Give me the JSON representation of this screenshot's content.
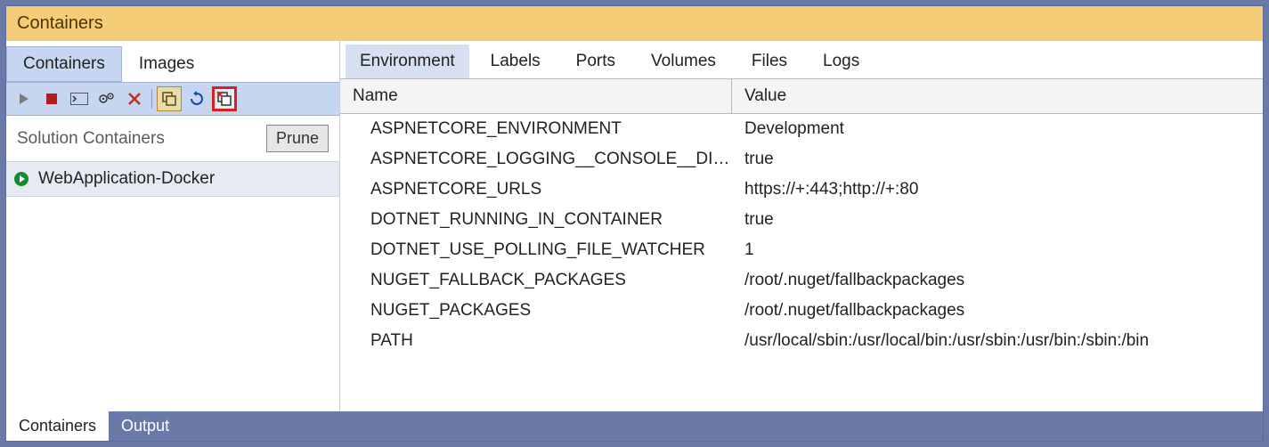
{
  "title": "Containers",
  "leftTabs": {
    "containers": "Containers",
    "images": "Images",
    "active": "containers"
  },
  "sidebar": {
    "sectionTitle": "Solution Containers",
    "tooltip": "Prune",
    "items": [
      {
        "label": "WebApplication-Docker",
        "running": true
      }
    ]
  },
  "rightTabs": {
    "items": [
      "Environment",
      "Labels",
      "Ports",
      "Volumes",
      "Files",
      "Logs"
    ],
    "active": 0
  },
  "table": {
    "columns": {
      "name": "Name",
      "value": "Value"
    },
    "rows": [
      {
        "name": "ASPNETCORE_ENVIRONMENT",
        "value": "Development"
      },
      {
        "name": "ASPNETCORE_LOGGING__CONSOLE__DISA...",
        "value": "true"
      },
      {
        "name": "ASPNETCORE_URLS",
        "value": "https://+:443;http://+:80"
      },
      {
        "name": "DOTNET_RUNNING_IN_CONTAINER",
        "value": "true"
      },
      {
        "name": "DOTNET_USE_POLLING_FILE_WATCHER",
        "value": "1"
      },
      {
        "name": "NUGET_FALLBACK_PACKAGES",
        "value": "/root/.nuget/fallbackpackages"
      },
      {
        "name": "NUGET_PACKAGES",
        "value": "/root/.nuget/fallbackpackages"
      },
      {
        "name": "PATH",
        "value": "/usr/local/sbin:/usr/local/bin:/usr/sbin:/usr/bin:/sbin:/bin"
      }
    ]
  },
  "bottomTabs": {
    "items": [
      "Containers",
      "Output"
    ],
    "active": 1
  }
}
